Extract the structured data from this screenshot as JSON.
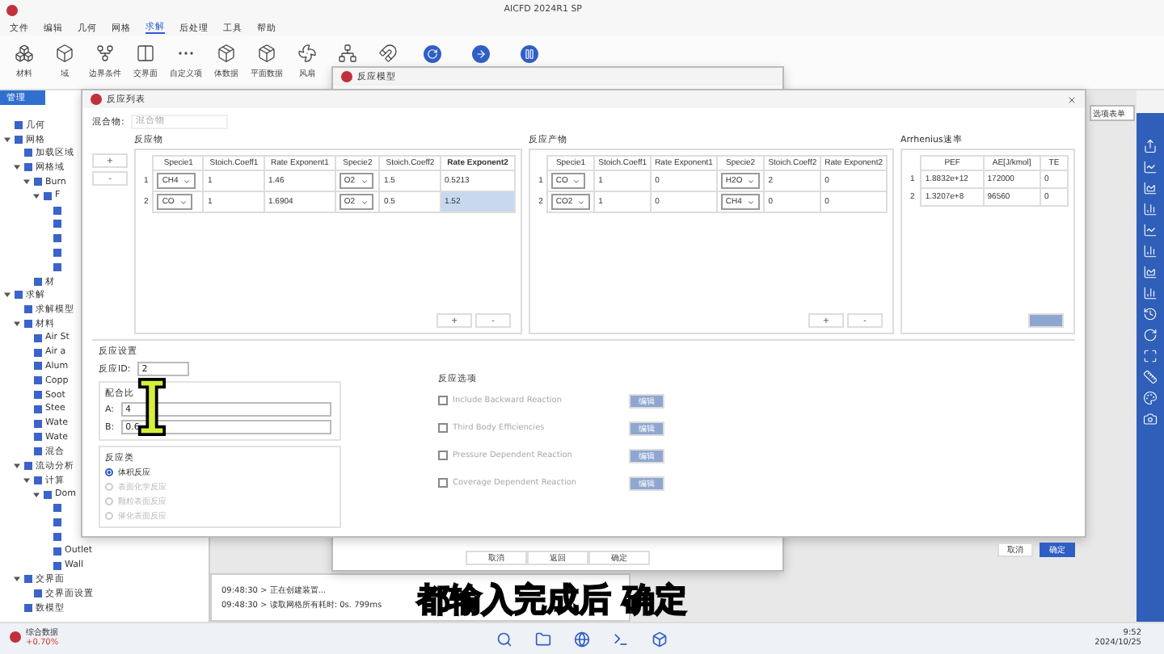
{
  "window": {
    "title": "AICFD 2024R1 SP"
  },
  "menu": [
    {
      "label": "文件",
      "selected": false
    },
    {
      "label": "编辑",
      "selected": false
    },
    {
      "label": "几何",
      "selected": false
    },
    {
      "label": "网格",
      "selected": false
    },
    {
      "label": "求解",
      "selected": true
    },
    {
      "label": "后处理",
      "selected": false
    },
    {
      "label": "工具",
      "selected": false
    },
    {
      "label": "帮助",
      "selected": false
    }
  ],
  "ribbon": [
    {
      "label": "材料",
      "kind": "material"
    },
    {
      "label": "域",
      "kind": "domain"
    },
    {
      "label": "边界条件",
      "kind": "boundary"
    },
    {
      "label": "交界面",
      "kind": "interface"
    },
    {
      "label": "自定义项",
      "kind": "more"
    },
    {
      "label": "体数据",
      "kind": "cube"
    },
    {
      "label": "平面数据",
      "kind": "cube"
    },
    {
      "label": "风扇",
      "kind": "fan"
    },
    {
      "kind": "tree"
    },
    {
      "kind": "magnet"
    },
    {
      "kind": "refresh"
    },
    {
      "kind": "arrow"
    },
    {
      "kind": "pause"
    }
  ],
  "tree": {
    "header": "管理",
    "items": [
      {
        "kind": "node",
        "label": "几何"
      },
      {
        "kind": "node",
        "label": "网格",
        "expanded": true,
        "children": [
          {
            "kind": "node",
            "label": "加载区域"
          },
          {
            "kind": "node",
            "label": "网格域",
            "expanded": true,
            "children": [
              {
                "kind": "node",
                "label": "Burn",
                "expanded": true,
                "children": [
                  {
                    "kind": "node",
                    "label": "F",
                    "expanded": true,
                    "children": [
                      {
                        "kind": "icon"
                      },
                      {
                        "kind": "icon"
                      },
                      {
                        "kind": "icon"
                      },
                      {
                        "kind": "icon"
                      },
                      {
                        "kind": "icon"
                      }
                    ]
                  }
                ]
              },
              {
                "kind": "node",
                "label": "材"
              }
            ]
          }
        ]
      },
      {
        "kind": "node",
        "label": "求解",
        "expanded": true,
        "children": [
          {
            "kind": "node",
            "label": "求解模型"
          },
          {
            "kind": "node",
            "label": "材料",
            "expanded": true,
            "children": [
              {
                "kind": "node",
                "label": "Air St"
              },
              {
                "kind": "node",
                "label": "Air a"
              },
              {
                "kind": "node",
                "label": "Alum"
              },
              {
                "kind": "node",
                "label": "Copp"
              },
              {
                "kind": "node",
                "label": "Soot"
              },
              {
                "kind": "node",
                "label": "Stee"
              },
              {
                "kind": "node",
                "label": "Wate"
              },
              {
                "kind": "node",
                "label": "Wate"
              },
              {
                "kind": "node",
                "label": "混合"
              }
            ]
          },
          {
            "kind": "node",
            "label": "流动分析",
            "expanded": true,
            "children": [
              {
                "kind": "node",
                "label": "计算",
                "expanded": true,
                "children": [
                  {
                    "kind": "node",
                    "label": "Dom",
                    "expanded": true,
                    "children": [
                      {
                        "kind": "icon"
                      },
                      {
                        "kind": "icon"
                      },
                      {
                        "kind": "icon"
                      },
                      {
                        "kind": "node",
                        "label": "Outlet"
                      },
                      {
                        "kind": "node",
                        "label": "Wall"
                      }
                    ]
                  }
                ]
              }
            ]
          },
          {
            "kind": "node",
            "label": "交界面",
            "expanded": true,
            "children": [
              {
                "kind": "node",
                "label": "交界面设置"
              }
            ]
          },
          {
            "kind": "node",
            "label": "数模型"
          }
        ]
      }
    ]
  },
  "widget": {
    "title": "综合数据",
    "change": "+0.70%"
  },
  "option_select": {
    "value": "选项表单"
  },
  "back_dialog": {
    "title": "反应模型",
    "buttons": [
      {
        "label": "取消",
        "primary": false
      },
      {
        "label": "返回",
        "primary": false
      },
      {
        "label": "确定",
        "primary": false
      }
    ]
  },
  "log": [
    "09:48:30 > 正在创建装置...",
    "09:48:30 > 读取网格所有耗时: 0s. 799ms"
  ],
  "dialog": {
    "title": "反应列表",
    "mixture_label": "混合物:",
    "mixture_placeholder": "混合物",
    "side_buttons": [
      "+",
      "-"
    ],
    "reactants": {
      "title": "反应物",
      "columns": [
        {
          "label": "Specie1",
          "selected": false
        },
        {
          "label": "Stoich.Coeff1",
          "selected": false
        },
        {
          "label": "Rate Exponent1",
          "selected": false
        },
        {
          "label": "Specie2",
          "selected": false
        },
        {
          "label": "Stoich.Coeff2",
          "selected": false
        },
        {
          "label": "Rate Exponent2",
          "selected": true
        }
      ],
      "rows": [
        {
          "index": "1",
          "cells": [
            {
              "text": "CH4",
              "kind": "select",
              "selected": false
            },
            {
              "text": "1",
              "kind": "text",
              "selected": false
            },
            {
              "text": "1.46",
              "kind": "text",
              "selected": false
            },
            {
              "text": "O2",
              "kind": "select",
              "selected": false
            },
            {
              "text": "1.5",
              "kind": "text",
              "selected": false
            },
            {
              "text": "0.5213",
              "kind": "text",
              "selected": false
            }
          ]
        },
        {
          "index": "2",
          "cells": [
            {
              "text": "CO",
              "kind": "select",
              "selected": false
            },
            {
              "text": "1",
              "kind": "text",
              "selected": false
            },
            {
              "text": "1.6904",
              "kind": "text",
              "selected": false
            },
            {
              "text": "O2",
              "kind": "select",
              "selected": false
            },
            {
              "text": "0.5",
              "kind": "text",
              "selected": false
            },
            {
              "text": "1.52",
              "kind": "text",
              "selected": true
            }
          ]
        }
      ],
      "buttons": [
        "+",
        "-"
      ]
    },
    "products": {
      "title": "反应产物",
      "columns": [
        {
          "label": "Specie1",
          "selected": false
        },
        {
          "label": "Stoich.Coeff1",
          "selected": false
        },
        {
          "label": "Rate Exponent1",
          "selected": false
        },
        {
          "label": "Specie2",
          "selected": false
        },
        {
          "label": "Stoich.Coeff2",
          "selected": false
        },
        {
          "label": "Rate Exponent2",
          "selected": false
        }
      ],
      "rows": [
        {
          "index": "1",
          "cells": [
            {
              "text": "CO",
              "kind": "select",
              "selected": false
            },
            {
              "text": "1",
              "kind": "text",
              "selected": false
            },
            {
              "text": "0",
              "kind": "text",
              "selected": false
            },
            {
              "text": "H2O",
              "kind": "select",
              "selected": false
            },
            {
              "text": "2",
              "kind": "text",
              "selected": false
            },
            {
              "text": "0",
              "kind": "text",
              "selected": false
            }
          ]
        },
        {
          "index": "2",
          "cells": [
            {
              "text": "CO2",
              "kind": "select",
              "selected": false
            },
            {
              "text": "1",
              "kind": "text",
              "selected": false
            },
            {
              "text": "0",
              "kind": "text",
              "selected": false
            },
            {
              "text": "CH4",
              "kind": "select",
              "selected": false
            },
            {
              "text": "0",
              "kind": "text",
              "selected": false
            },
            {
              "text": "0",
              "kind": "text",
              "selected": false
            }
          ]
        }
      ],
      "buttons": [
        "+",
        "-"
      ]
    },
    "arrhenius": {
      "title": "Arrhenius速率",
      "columns": [
        {
          "label": "PEF",
          "selected": false
        },
        {
          "label": "AE[J/kmol]",
          "selected": false
        },
        {
          "label": "TE",
          "selected": false
        }
      ],
      "rows": [
        {
          "index": "1",
          "cells": [
            {
              "text": "1.8832e+12",
              "kind": "text",
              "selected": false
            },
            {
              "text": "172000",
              "kind": "text",
              "selected": false
            },
            {
              "text": "0",
              "kind": "text",
              "selected": false
            }
          ]
        },
        {
          "index": "2",
          "cells": [
            {
              "text": "1.3207e+8",
              "kind": "text",
              "selected": false
            },
            {
              "text": "96560",
              "kind": "text",
              "selected": false
            },
            {
              "text": "0",
              "kind": "text",
              "selected": false
            }
          ]
        }
      ]
    },
    "settings": {
      "title": "反应设置",
      "id_label": "反应ID:",
      "id_value": "2",
      "ratio_title": "配合比",
      "ratio": [
        {
          "label": "A:",
          "value": "4"
        },
        {
          "label": "B:",
          "value": "0.6"
        }
      ],
      "type_title": "反应类",
      "types": [
        {
          "label": "体积反应",
          "selected": true,
          "disabled": false
        },
        {
          "label": "表面化学反应",
          "selected": false,
          "disabled": true
        },
        {
          "label": "颗粒表面反应",
          "selected": false,
          "disabled": true
        },
        {
          "label": "催化表面反应",
          "selected": false,
          "disabled": true
        }
      ],
      "options_title": "反应选项",
      "options": [
        {
          "label": "Include Backward Reaction",
          "checked": false,
          "button": "编辑",
          "disabled": true
        },
        {
          "label": "Third Body Efficiencies",
          "checked": false,
          "button": "编辑",
          "disabled": true
        },
        {
          "label": "Pressure Dependent Reaction",
          "checked": false,
          "button": "编辑",
          "disabled": true
        },
        {
          "label": "Coverage Dependent Reaction",
          "checked": false,
          "button": "编辑",
          "disabled": true
        }
      ]
    },
    "footer": [
      {
        "label": "取消",
        "primary": false
      },
      {
        "label": "确定",
        "primary": true
      }
    ]
  },
  "caption": "都输入完成后 确定",
  "taskbar": {
    "time": "9:52",
    "date": "2024/10/25"
  }
}
